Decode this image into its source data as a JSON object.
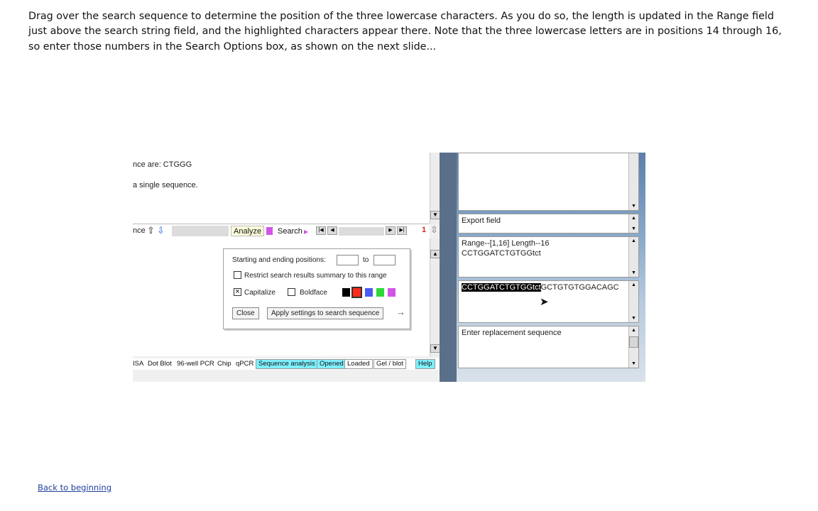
{
  "slide": {
    "instructions": "Drag over the search sequence to determine the position of the three lowercase characters. As you do so, the length is updated in the Range field just above the search string field, and the highlighted characters appear there.  Note that the three lowercase letters are in positions 14 through 16, so enter those numbers in the Search Options box, as shown on the next slide...",
    "back_link": "Back to beginning"
  },
  "left_panel": {
    "line1": "nce are:  CTGGG",
    "line2": "a single sequence.",
    "toolbar": {
      "partial_label": "nce",
      "analyze": "Analyze",
      "search": "Search",
      "counter": "1"
    }
  },
  "search_options": {
    "positions_label": "Starting and ending positions:",
    "start_value": "",
    "to_label": "to",
    "end_value": "",
    "restrict_label": "Restrict search results summary to this range",
    "restrict_checked": false,
    "capitalize_label": "Capitalize",
    "capitalize_checked": true,
    "capitalize_mark": "×",
    "boldface_label": "Boldface",
    "boldface_checked": false,
    "swatches": [
      "#000000",
      "#ff2a1a",
      "#4a5cf0",
      "#2ed83a",
      "#d255e8"
    ],
    "selected_swatch": "#ff2a1a",
    "close_label": "Close",
    "apply_label": "Apply settings to search sequence",
    "apply_arrow": "→"
  },
  "bottom_tabs": {
    "plain": [
      "ISA",
      "Dot Blot",
      "96-well PCR",
      "Chip",
      "qPCR"
    ],
    "boxed": [
      {
        "label": "Sequence analysis",
        "active": true
      },
      {
        "label": "Opened",
        "active": true
      },
      {
        "label": "Loaded",
        "active": false
      },
      {
        "label": "Gel / blot",
        "active": false
      },
      {
        "label": "Help",
        "active": true
      }
    ]
  },
  "right_panel": {
    "export_label": "Export field",
    "range_label": "Range--[1,16]  Length--16",
    "range_sequence": "CCTGGATCTGTGGtct",
    "search_selected": "CCTGGATCTGTGGtct",
    "search_rest": "GCTGTGTGGACAGC",
    "replacement_label": "Enter replacement sequence"
  },
  "colors": {
    "highlight_tab": "#7ff0ff",
    "button_bg": "#ffffdd",
    "link": "#1f3f9f"
  }
}
